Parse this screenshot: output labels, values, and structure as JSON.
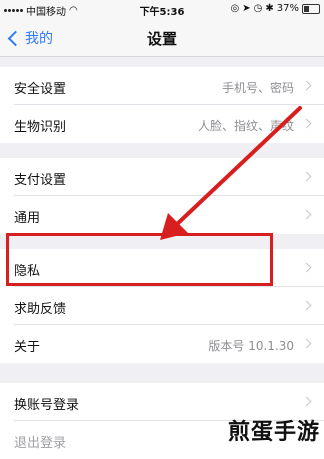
{
  "status": {
    "carrier": "中国移动",
    "time": "下午5:36",
    "battery": "37%"
  },
  "nav": {
    "back_label": "我的",
    "title": "设置"
  },
  "rows": [
    {
      "label": "安全设置",
      "value": "手机号、密码"
    },
    {
      "label": "生物识别",
      "value": "人脸、指纹、声纹"
    },
    {
      "label": "支付设置",
      "value": ""
    },
    {
      "label": "通用",
      "value": ""
    },
    {
      "label": "隐私",
      "value": ""
    },
    {
      "label": "求助反馈",
      "value": ""
    },
    {
      "label": "关于",
      "value": "版本号 10.1.30"
    },
    {
      "label": "换账号登录",
      "value": ""
    },
    {
      "label": "退出登录",
      "value": ""
    }
  ],
  "watermark": "煎蛋手游",
  "colors": {
    "accent": "#2f7bf6",
    "annotation": "#d71f1f",
    "background": "#efeff4"
  }
}
